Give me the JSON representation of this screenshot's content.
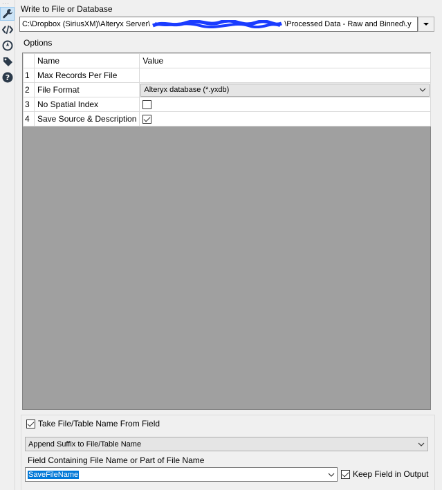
{
  "rail": {
    "grip": "···",
    "icons": [
      "wrench-icon",
      "code-icon",
      "compass-icon",
      "tag-icon",
      "help-icon"
    ]
  },
  "write_section": {
    "label": "Write to File or Database",
    "path_prefix": "C:\\Dropbox (SiriusXM)\\Alteryx Server\\",
    "path_suffix": "\\Processed Data - Raw and Binned\\.y"
  },
  "options": {
    "label": "Options",
    "headers": {
      "name": "Name",
      "value": "Value"
    },
    "rows": [
      {
        "index": "1",
        "name": "Max Records Per File"
      },
      {
        "index": "2",
        "name": "File Format",
        "value": "Alteryx database (*.yxdb)"
      },
      {
        "index": "3",
        "name": "No Spatial Index"
      },
      {
        "index": "4",
        "name": "Save Source & Description"
      }
    ],
    "checked": {
      "no_spatial_index": false,
      "save_source": true
    }
  },
  "bottom": {
    "take_name_label": "Take File/Table Name From Field",
    "take_name_checked": true,
    "append_option": "Append Suffix to File/Table Name",
    "field_label": "Field Containing File Name or Part of File Name",
    "field_value": "SaveFileName",
    "keep_field_label": "Keep Field in Output",
    "keep_field_checked": true
  },
  "colors": {
    "accent": "#0078d7",
    "redact": "#1a3cff"
  }
}
